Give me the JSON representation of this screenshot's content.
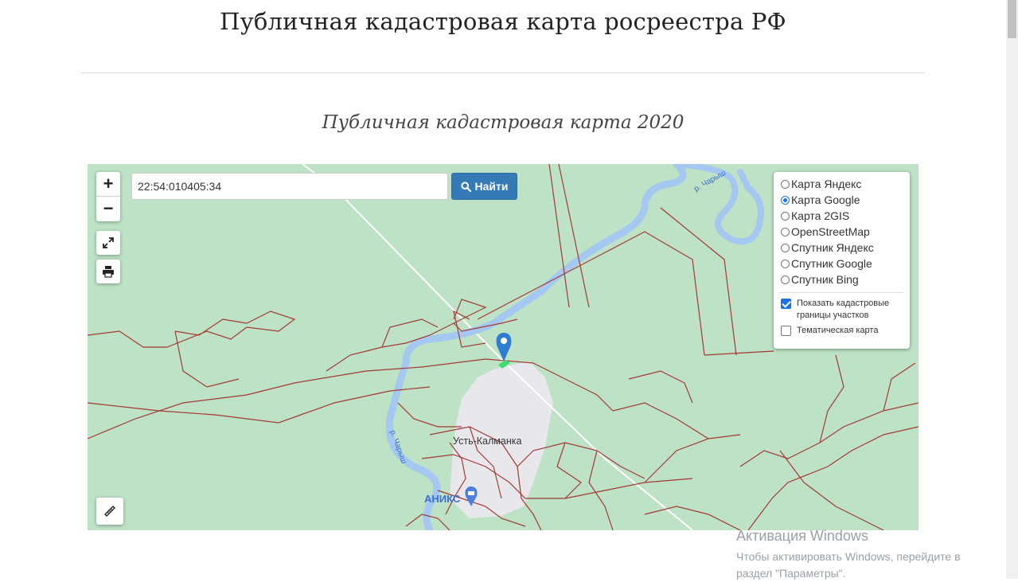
{
  "page": {
    "title": "Публичная кадастровая карта росреестра РФ",
    "subtitle": "Публичная кадастровая карта 2020"
  },
  "map": {
    "zoom_in": "+",
    "zoom_out": "−",
    "search": {
      "value": "22:54:010405:34",
      "button_label": "Найти"
    },
    "layers": [
      {
        "label": "Карта Яндекс",
        "selected": false
      },
      {
        "label": "Карта Google",
        "selected": true
      },
      {
        "label": "Карта 2GIS",
        "selected": false
      },
      {
        "label": "OpenStreetMap",
        "selected": false
      },
      {
        "label": "Спутник Яндекс",
        "selected": false
      },
      {
        "label": "Спутник Google",
        "selected": false
      },
      {
        "label": "Спутник Bing",
        "selected": false
      }
    ],
    "options": [
      {
        "label": "Показать кадастровые границы участков",
        "checked": true
      },
      {
        "label": "Тематическая карта",
        "checked": false
      }
    ],
    "labels": {
      "settlement": "Усть-Калманка",
      "river_top": "р. Чарыш",
      "river_left": "р. Чарыш",
      "store": "АНИКС"
    },
    "colors": {
      "land": "#bde2c6",
      "river": "#a4c8f0",
      "boundary": "#a33a33",
      "settlement": "#e8e8ec"
    }
  },
  "watermark": {
    "title": "Активация Windows",
    "line1": "Чтобы активировать Windows, перейдите в",
    "line2": "раздел \"Параметры\"."
  }
}
